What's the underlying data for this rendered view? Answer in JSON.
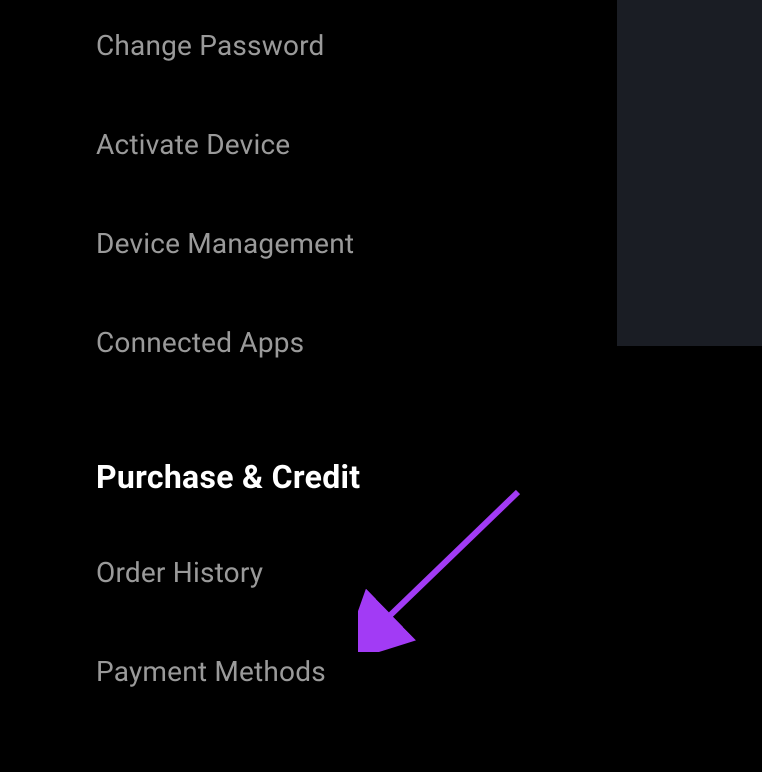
{
  "menu": {
    "items": [
      {
        "label": "Change Password",
        "name": "change-password"
      },
      {
        "label": "Activate Device",
        "name": "activate-device"
      },
      {
        "label": "Device Management",
        "name": "device-management"
      },
      {
        "label": "Connected Apps",
        "name": "connected-apps"
      }
    ]
  },
  "section": {
    "title": "Purchase & Credit",
    "items": [
      {
        "label": "Order History",
        "name": "order-history"
      },
      {
        "label": "Payment Methods",
        "name": "payment-methods"
      }
    ]
  },
  "annotation": {
    "arrow_color": "#a23bf5"
  }
}
